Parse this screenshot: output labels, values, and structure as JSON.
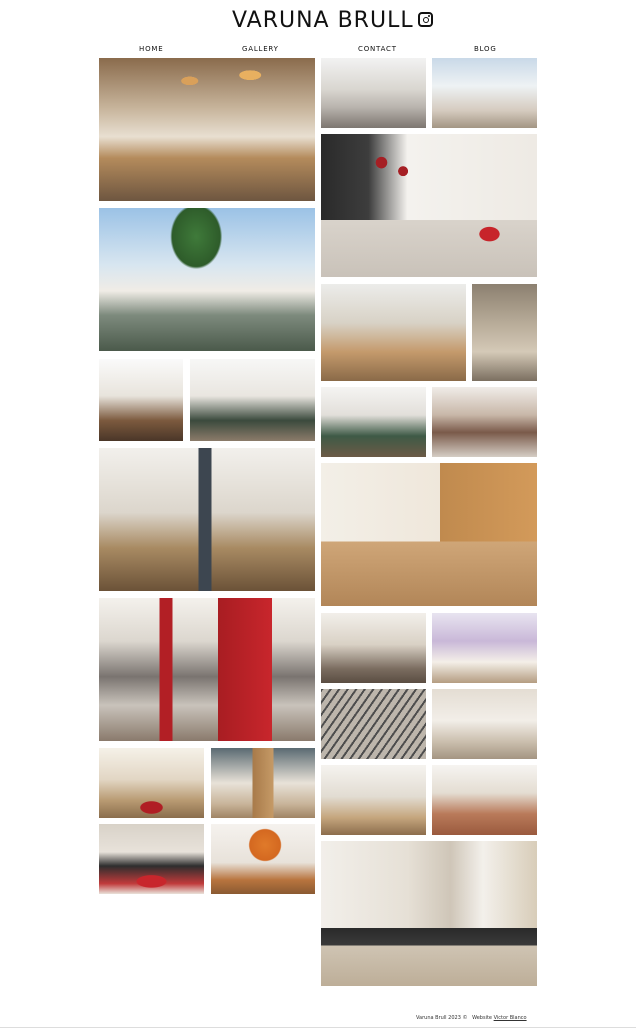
{
  "header": {
    "site_title": "VARUNA BRULL",
    "instagram_icon": "instagram-icon"
  },
  "nav": {
    "items": [
      {
        "label": "HOME"
      },
      {
        "label": "GALLERY"
      },
      {
        "label": "CONTACT"
      },
      {
        "label": "BLOG"
      }
    ]
  },
  "gallery": {
    "photos": [
      "restaurant-interior-lamps",
      "restaurant-dining-room",
      "restaurant-terrace-sea-view",
      "cafe-red-lamps-counter",
      "outdoor-terrace-palm-trees",
      "kitchen-counter-bar",
      "gallery-glass-roof",
      "dining-room-table",
      "office-lounge",
      "living-room",
      "shop-display",
      "restaurant-tree-decor",
      "kitchen-wood-cabinets",
      "restaurant-red-wall",
      "hallway-interior",
      "cafe-bar-purple-light",
      "market-iron-roof",
      "open-kitchen-interior",
      "dining-wood-table",
      "wall-art-interior",
      "living-room-red-rug",
      "pastry-shop-counter",
      "bar-red-tablecloth",
      "orange-moon-wall-dining",
      "hair-salon-interior"
    ]
  },
  "footer": {
    "copyright": "Varuna Brull 2023 ©",
    "website_label": "Website",
    "website_author": "Victor Blanco"
  }
}
